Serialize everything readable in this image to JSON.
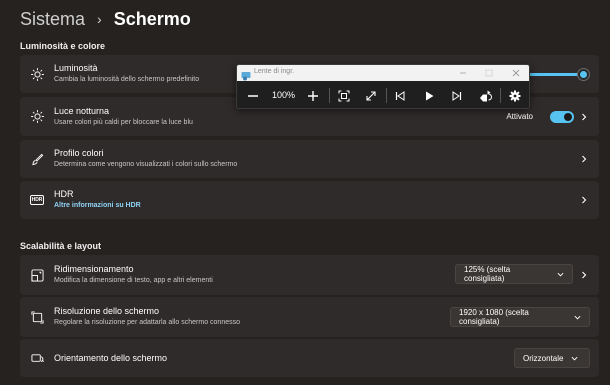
{
  "breadcrumb": {
    "parent": "Sistema",
    "separator": "›",
    "current": "Schermo"
  },
  "sections": {
    "brightness_color": "Luminosità e colore",
    "scale_layout": "Scalabilità e layout"
  },
  "cards": {
    "brightness": {
      "title": "Luminosità",
      "subtitle": "Cambia la luminosità dello schermo predefinito",
      "slider_level_percent": 100
    },
    "night_light": {
      "title": "Luce notturna",
      "subtitle": "Usare colori più caldi per bloccare la luce blu",
      "toggle_label": "Attivato",
      "toggle_on": true
    },
    "color_profile": {
      "title": "Profilo colori",
      "subtitle": "Determina come vengono visualizzati i colori sullo schermo"
    },
    "hdr": {
      "title": "HDR",
      "subtitle": "Altre informazioni su HDR",
      "icon_text": "HDR"
    },
    "scale": {
      "title": "Ridimensionamento",
      "subtitle": "Modifica la dimensione di testo, app e altri elementi",
      "value": "125% (scelta consigliata)"
    },
    "resolution": {
      "title": "Risoluzione dello schermo",
      "subtitle": "Regolare la risoluzione per adattarla allo schermo connesso",
      "value": "1920 x 1080 (scelta consigliata)"
    },
    "orientation": {
      "title": "Orientamento dello schermo",
      "value": "Orizzontale"
    }
  },
  "magnifier": {
    "title": "Lente di ingr.",
    "zoom": "100%"
  },
  "colors": {
    "accent": "#57c3f0",
    "background": "#262220",
    "card": "#2f2b2a"
  }
}
